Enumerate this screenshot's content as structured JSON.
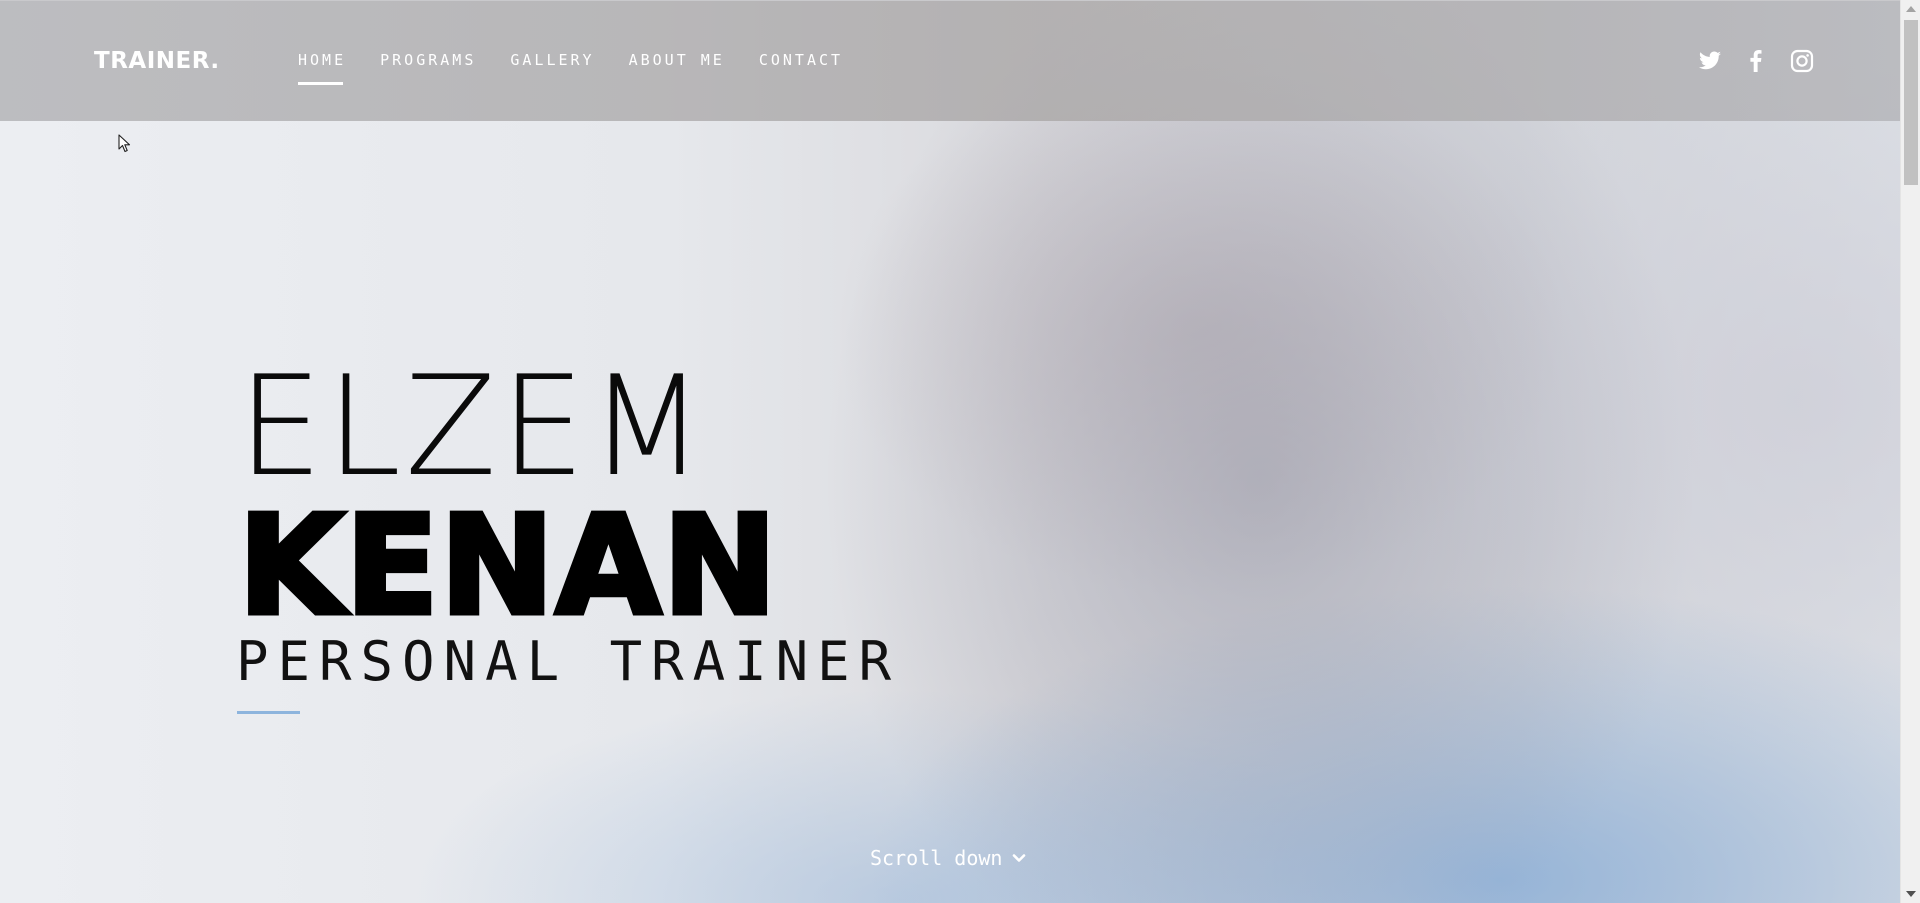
{
  "brand": {
    "logo": "TRAINER."
  },
  "nav": {
    "items": [
      {
        "label": "HOME",
        "active": true
      },
      {
        "label": "PROGRAMS",
        "active": false
      },
      {
        "label": "GALLERY",
        "active": false
      },
      {
        "label": "ABOUT ME",
        "active": false
      },
      {
        "label": "CONTACT",
        "active": false
      }
    ]
  },
  "socials": [
    "twitter-icon",
    "facebook-icon",
    "instagram-icon"
  ],
  "hero": {
    "first_name": "ELZEM",
    "last_name": "KENAN",
    "role": "PERSONAL TRAINER",
    "accent_color": "#8db4dd"
  },
  "scroll": {
    "label": "Scroll down",
    "icon": "chevron-down-icon"
  }
}
